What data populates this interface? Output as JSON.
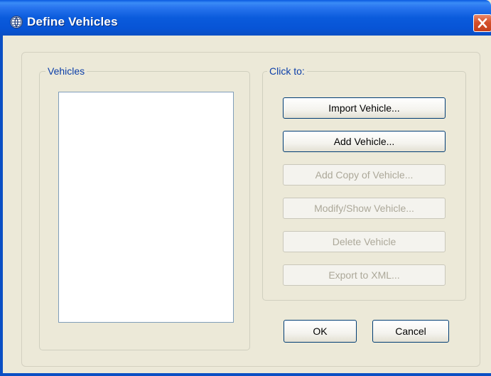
{
  "window": {
    "title": "Define Vehicles"
  },
  "vehicles_group": {
    "legend": "Vehicles",
    "items": []
  },
  "actions_group": {
    "legend": "Click to:",
    "buttons": [
      {
        "label": "Import Vehicle...",
        "enabled": true
      },
      {
        "label": "Add Vehicle...",
        "enabled": true
      },
      {
        "label": "Add Copy of Vehicle...",
        "enabled": false
      },
      {
        "label": "Modify/Show Vehicle...",
        "enabled": false
      },
      {
        "label": "Delete Vehicle",
        "enabled": false
      },
      {
        "label": "Export to XML...",
        "enabled": false
      }
    ]
  },
  "dialog_buttons": {
    "ok": "OK",
    "cancel": "Cancel"
  },
  "colors": {
    "titlebar": "#0a5bdc",
    "legend_text": "#0b3ea8",
    "disabled_text": "#aca899",
    "close_button": "#d4502c"
  }
}
